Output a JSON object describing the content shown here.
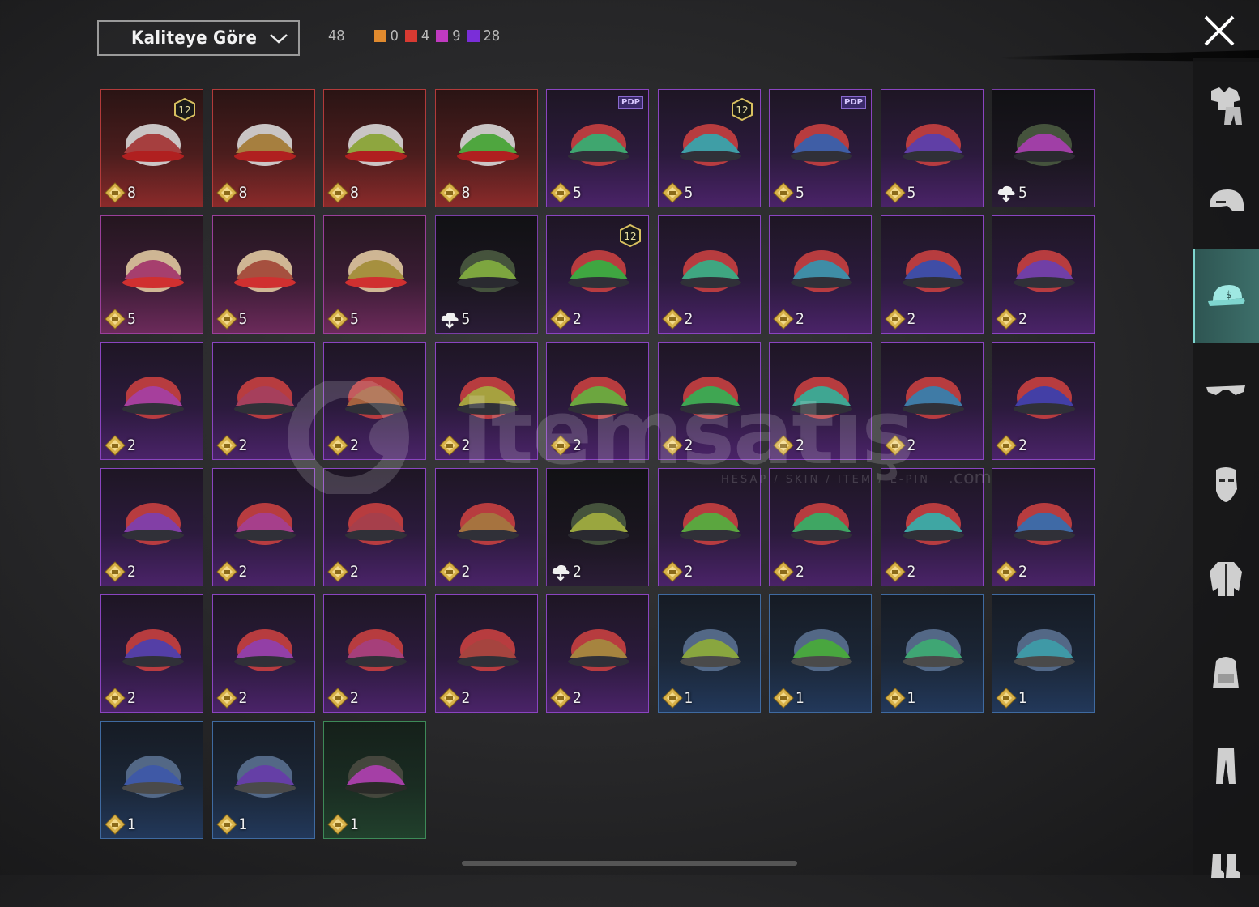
{
  "sort": {
    "label": "Kaliteye Göre"
  },
  "counts": {
    "total": "48",
    "items": [
      {
        "value": "0",
        "color": "#e08a2e"
      },
      {
        "value": "4",
        "color": "#d83a32"
      },
      {
        "value": "9",
        "color": "#c03ac0"
      },
      {
        "value": "28",
        "color": "#7a2ed8"
      }
    ]
  },
  "watermark": {
    "brand": "itemsatış",
    "tagline": "HESAP / SKIN / ITEM / E-PIN",
    "suffix": ".com"
  },
  "items": [
    {
      "count": "8",
      "rarity": "legendary",
      "art": "white-hair-icon",
      "level": "12"
    },
    {
      "count": "8",
      "rarity": "legendary",
      "art": "white-cowboy-hat-icon"
    },
    {
      "count": "8",
      "rarity": "legendary",
      "art": "red-mask-helmet-icon"
    },
    {
      "count": "8",
      "rarity": "legendary",
      "art": "red-visor-helmet-icon"
    },
    {
      "count": "5",
      "rarity": "epic",
      "art": "patterned-cap-icon",
      "tag": "PDP"
    },
    {
      "count": "5",
      "rarity": "epic",
      "art": "orange-hair-icon",
      "level": "12"
    },
    {
      "count": "5",
      "rarity": "epic",
      "art": "panda-head-icon",
      "tag": "PDP"
    },
    {
      "count": "5",
      "rarity": "epic",
      "art": "red-demon-mask-icon"
    },
    {
      "count": "5",
      "rarity": "dark",
      "art": "gold-wrestler-mask-icon",
      "cloud": true
    },
    {
      "count": "5",
      "rarity": "epic pinkish",
      "art": "cake-hat-icon"
    },
    {
      "count": "5",
      "rarity": "epic pinkish",
      "art": "lion-head-icon"
    },
    {
      "count": "5",
      "rarity": "epic pinkish",
      "art": "frog-hat-icon"
    },
    {
      "count": "5",
      "rarity": "dark",
      "art": "military-helmet-icon",
      "cloud": true
    },
    {
      "count": "2",
      "rarity": "epic",
      "art": "bunny-ears-helmet-icon",
      "level": "12"
    },
    {
      "count": "2",
      "rarity": "epic",
      "art": "blue-cap-icon"
    },
    {
      "count": "2",
      "rarity": "epic",
      "art": "black-helmet-icon"
    },
    {
      "count": "2",
      "rarity": "epic",
      "art": "holographic-cap-icon"
    },
    {
      "count": "2",
      "rarity": "epic",
      "art": "red-white-cap-icon"
    },
    {
      "count": "2",
      "rarity": "epic",
      "art": "orange-beanie-icon"
    },
    {
      "count": "2",
      "rarity": "epic",
      "art": "gold-red-cap-icon"
    },
    {
      "count": "2",
      "rarity": "epic",
      "art": "red-football-helmet-icon"
    },
    {
      "count": "2",
      "rarity": "epic",
      "art": "green-cap-icon"
    },
    {
      "count": "2",
      "rarity": "epic",
      "art": "long-hair-helmet-icon"
    },
    {
      "count": "2",
      "rarity": "epic",
      "art": "mushroom-hat-icon"
    },
    {
      "count": "2",
      "rarity": "epic",
      "art": "bunny-headband-icon"
    },
    {
      "count": "2",
      "rarity": "epic",
      "art": "neon-helmet-icon"
    },
    {
      "count": "2",
      "rarity": "epic",
      "art": "shark-hat-icon"
    },
    {
      "count": "2",
      "rarity": "epic",
      "art": "black-top-hat-icon"
    },
    {
      "count": "2",
      "rarity": "epic",
      "art": "red-fedora-icon"
    },
    {
      "count": "2",
      "rarity": "epic",
      "art": "shark-head-icon"
    },
    {
      "count": "2",
      "rarity": "epic",
      "art": "red-bucket-hat-icon"
    },
    {
      "count": "2",
      "rarity": "dark",
      "art": "police-cap-icon",
      "cloud": true
    },
    {
      "count": "2",
      "rarity": "epic",
      "art": "cake-beanie-icon"
    },
    {
      "count": "2",
      "rarity": "epic",
      "art": "burger-hat-icon"
    },
    {
      "count": "2",
      "rarity": "epic",
      "art": "doctor-headband-icon"
    },
    {
      "count": "2",
      "rarity": "epic",
      "art": "navy-cap-icon"
    },
    {
      "count": "2",
      "rarity": "epic",
      "art": "black-yellow-cap-icon"
    },
    {
      "count": "2",
      "rarity": "epic",
      "art": "maroon-fedora-icon"
    },
    {
      "count": "2",
      "rarity": "epic",
      "art": "bandana-icon"
    },
    {
      "count": "2",
      "rarity": "epic",
      "art": "black-bucket-hat-icon"
    },
    {
      "count": "2",
      "rarity": "epic",
      "art": "aviator-helmet-icon"
    },
    {
      "count": "1",
      "rarity": "blue",
      "art": "brown-hair-icon"
    },
    {
      "count": "1",
      "rarity": "blue",
      "art": "blue-beret-icon"
    },
    {
      "count": "1",
      "rarity": "blue",
      "art": "grey-beret-icon"
    },
    {
      "count": "1",
      "rarity": "blue",
      "art": "tan-cap-icon"
    },
    {
      "count": "1",
      "rarity": "blue",
      "art": "tan-cap-2-icon"
    },
    {
      "count": "1",
      "rarity": "blue",
      "art": "camo-cap-headset-icon"
    },
    {
      "count": "1",
      "rarity": "green",
      "art": "patrol-cap-icon"
    }
  ]
}
